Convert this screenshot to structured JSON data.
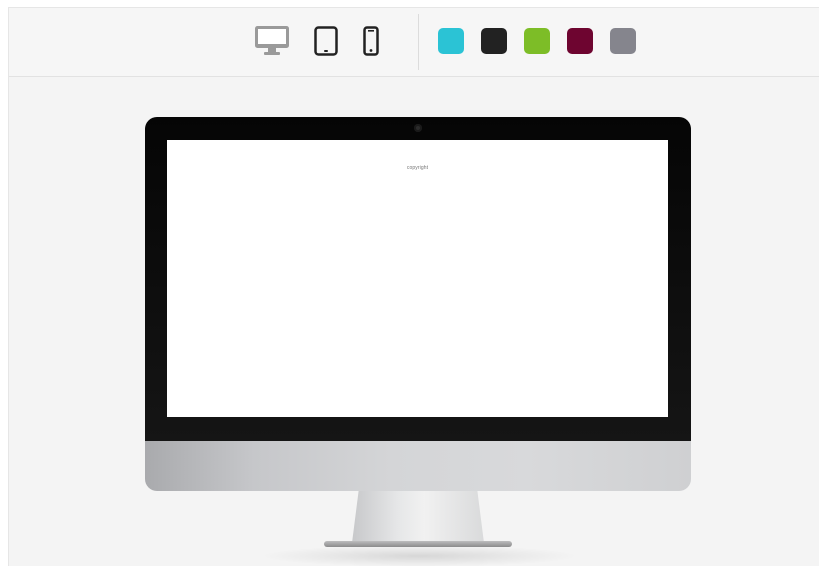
{
  "toolbar": {
    "devices": [
      {
        "name": "desktop",
        "icon": "desktop-icon",
        "active": true,
        "color": "#9a9a9a"
      },
      {
        "name": "tablet",
        "icon": "tablet-icon",
        "active": false,
        "color": "#222222"
      },
      {
        "name": "phone",
        "icon": "phone-icon",
        "active": false,
        "color": "#222222"
      }
    ],
    "swatches": [
      {
        "name": "cyan",
        "color": "#2bc3d5"
      },
      {
        "name": "black",
        "color": "#222222"
      },
      {
        "name": "green",
        "color": "#7dbd27"
      },
      {
        "name": "maroon",
        "color": "#6e0530"
      },
      {
        "name": "gray",
        "color": "#85858d"
      }
    ]
  },
  "preview": {
    "screen_text": "copyright"
  }
}
